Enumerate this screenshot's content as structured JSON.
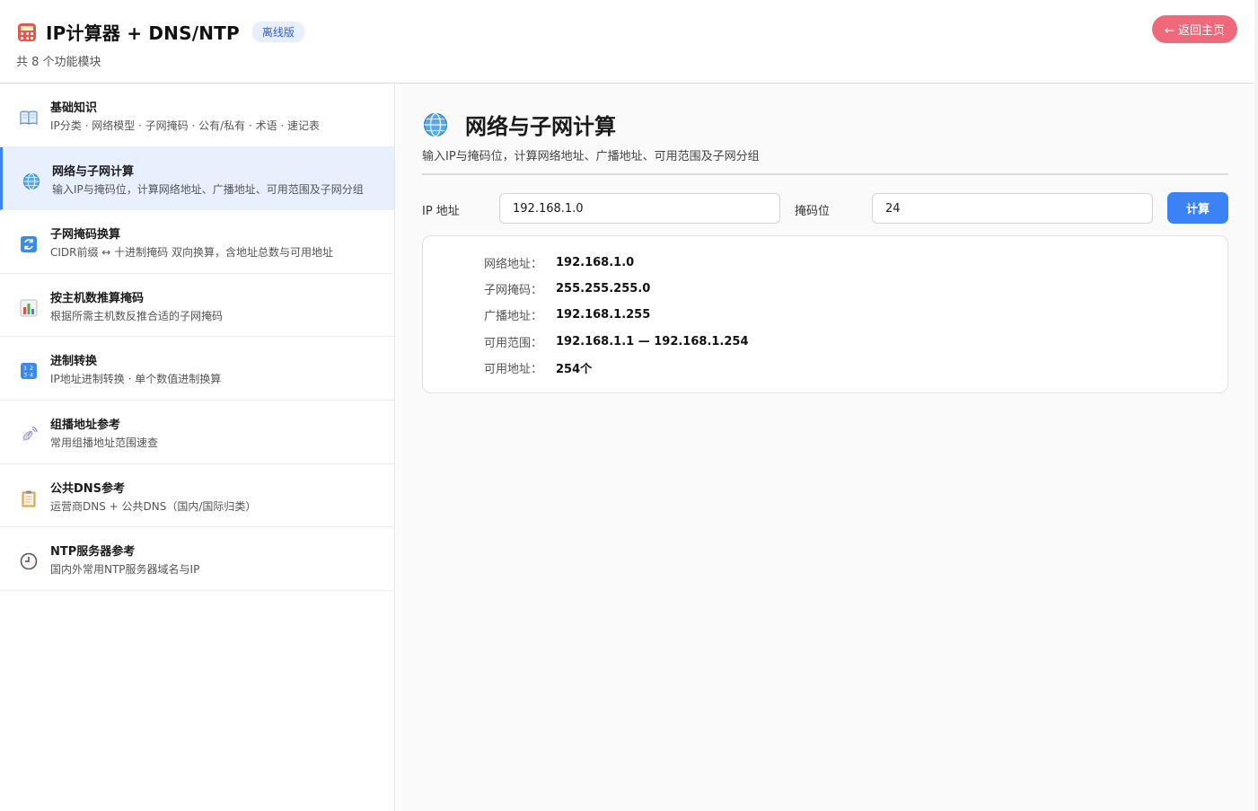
{
  "header": {
    "title": "IP计算器 + DNS/NTP",
    "badge": "离线版",
    "subtitle": "共 8 个功能模块",
    "home_button": "← 返回主页"
  },
  "sidebar": {
    "items": [
      {
        "icon": "book-icon",
        "title": "基础知识",
        "desc": "IP分类 · 网络模型 · 子网掩码 · 公有/私有 · 术语 · 速记表"
      },
      {
        "icon": "globe-icon",
        "title": "网络与子网计算",
        "desc": "输入IP与掩码位，计算网络地址、广播地址、可用范围及子网分组"
      },
      {
        "icon": "refresh-icon",
        "title": "子网掩码换算",
        "desc": "CIDR前缀 ↔ 十进制掩码 双向换算，含地址总数与可用地址"
      },
      {
        "icon": "bar-chart-icon",
        "title": "按主机数推算掩码",
        "desc": "根据所需主机数反推合适的子网掩码"
      },
      {
        "icon": "numbers-icon",
        "title": "进制转换",
        "desc": "IP地址进制转换 · 单个数值进制换算"
      },
      {
        "icon": "satellite-icon",
        "title": "组播地址参考",
        "desc": "常用组播地址范围速查"
      },
      {
        "icon": "clipboard-icon",
        "title": "公共DNS参考",
        "desc": "运营商DNS + 公共DNS（国内/国际归类）"
      },
      {
        "icon": "clock-icon",
        "title": "NTP服务器参考",
        "desc": "国内外常用NTP服务器域名与IP"
      }
    ]
  },
  "main": {
    "title": "网络与子网计算",
    "desc": "输入IP与掩码位，计算网络地址、广播地址、可用范围及子网分组",
    "ip_label": "IP 地址",
    "ip_value": "192.168.1.0",
    "mask_label": "掩码位",
    "mask_value": "24",
    "calc_button": "计算",
    "results": [
      {
        "key": "网络地址：",
        "value": "192.168.1.0"
      },
      {
        "key": "子网掩码：",
        "value": "255.255.255.0"
      },
      {
        "key": "广播地址：",
        "value": "192.168.1.255"
      },
      {
        "key": "可用范围：",
        "value": "192.168.1.1 — 192.168.1.254"
      },
      {
        "key": "可用地址：",
        "value": "254个"
      }
    ]
  },
  "colors": {
    "accent": "#3b82f6",
    "home_button": "#f0697a",
    "active_bg": "#e8f0fd",
    "badge_bg": "#e7efff",
    "badge_text": "#2b5fd9"
  }
}
